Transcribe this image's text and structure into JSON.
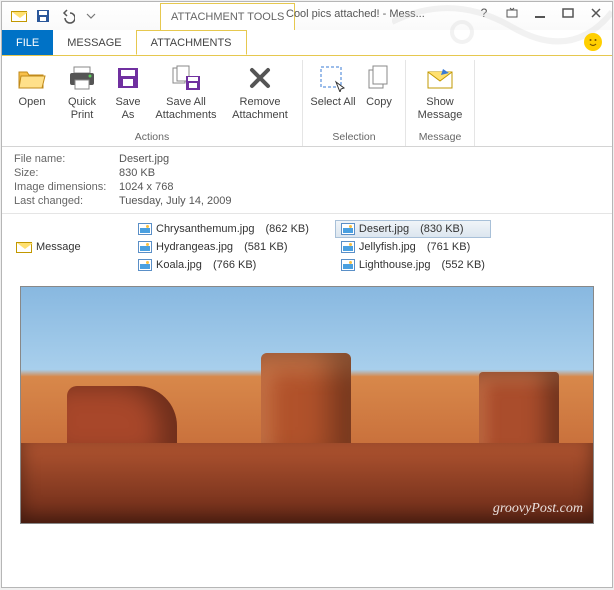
{
  "title": "Cool pics attached! - Mess...",
  "tools_tab": "ATTACHMENT TOOLS",
  "tabs": {
    "file": "FILE",
    "message": "MESSAGE",
    "attachments": "ATTACHMENTS"
  },
  "ribbon": {
    "open": "Open",
    "quick_print": "Quick Print",
    "save_as": "Save As",
    "save_all": "Save All Attachments",
    "remove": "Remove Attachment",
    "select_all": "Select All",
    "copy": "Copy",
    "show_msg": "Show Message",
    "group_actions": "Actions",
    "group_selection": "Selection",
    "group_message": "Message"
  },
  "details": {
    "filename_label": "File name:",
    "filename": "Desert.jpg",
    "size_label": "Size:",
    "size": "830 KB",
    "dims_label": "Image dimensions:",
    "dims": "1024 x 768",
    "changed_label": "Last changed:",
    "changed": "Tuesday, July 14, 2009"
  },
  "attbar": {
    "message": "Message",
    "items": [
      {
        "name": "Chrysanthemum.jpg",
        "size": "(862 KB)"
      },
      {
        "name": "Hydrangeas.jpg",
        "size": "(581 KB)"
      },
      {
        "name": "Koala.jpg",
        "size": "(766 KB)"
      },
      {
        "name": "Desert.jpg",
        "size": "(830 KB)",
        "selected": true
      },
      {
        "name": "Jellyfish.jpg",
        "size": "(761 KB)"
      },
      {
        "name": "Lighthouse.jpg",
        "size": "(552 KB)"
      }
    ]
  },
  "watermark": "groovyPost.com"
}
